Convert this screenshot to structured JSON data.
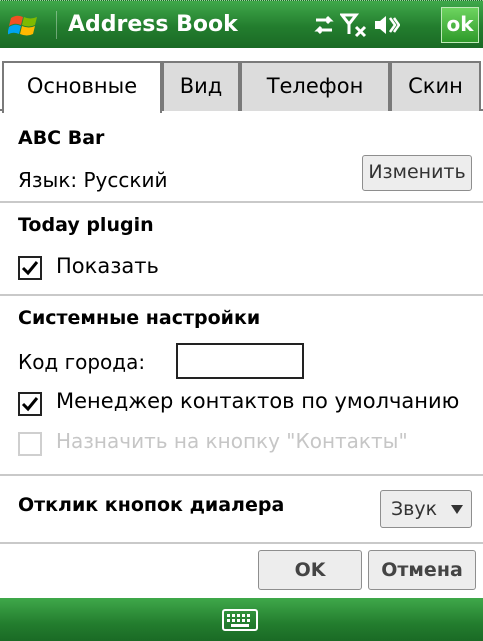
{
  "titlebar": {
    "title": "Address Book",
    "ok_label": "ok",
    "icons": [
      "start-logo",
      "connectivity-icon",
      "signal-off-icon",
      "volume-muted-icon"
    ]
  },
  "tabs": [
    {
      "label": "Основные",
      "active": true
    },
    {
      "label": "Вид",
      "active": false
    },
    {
      "label": "Телефон",
      "active": false
    },
    {
      "label": "Скин",
      "active": false
    }
  ],
  "abc_bar": {
    "heading": "ABC Bar",
    "language_label": "Язык: Русский",
    "change_button": "Изменить"
  },
  "today_plugin": {
    "heading": "Today plugin",
    "show_label": "Показать",
    "show_checked": true
  },
  "system": {
    "heading": "Системные настройки",
    "city_code_label": "Код города:",
    "city_code_value": "",
    "default_manager_label": "Менеджер контактов по умолчанию",
    "default_manager_checked": true,
    "assign_contacts_label": "Назначить на кнопку \"Контакты\"",
    "assign_contacts_checked": false,
    "assign_contacts_enabled": false
  },
  "dialer": {
    "heading": "Отклик кнопок диалера",
    "feedback_value": "Звук"
  },
  "footer": {
    "ok_label": "OK",
    "cancel_label": "Отмена"
  },
  "bottom_bar": {
    "icon": "keyboard-icon"
  }
}
